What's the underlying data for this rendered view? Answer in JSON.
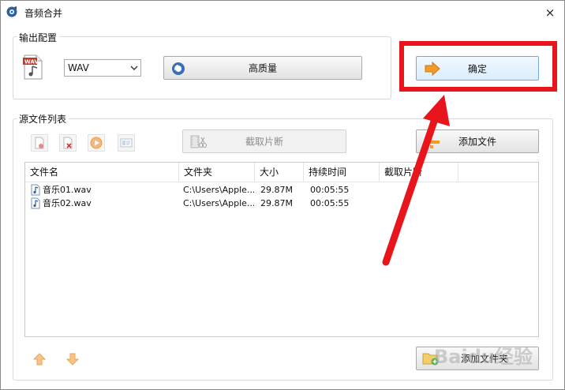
{
  "window": {
    "title": "音频合并",
    "close_glyph": "×"
  },
  "output_group": {
    "label": "输出配置",
    "format_icon_text": "WAV",
    "format_select": {
      "value": "WAV"
    },
    "quality_button": "高质量",
    "ok_button": "确定"
  },
  "source_group": {
    "label": "源文件列表",
    "clip_button": "截取片断",
    "add_file_button": "添加文件",
    "add_folder_button": "添加文件夹"
  },
  "list": {
    "columns": [
      "文件名",
      "文件夹",
      "大小",
      "持续时间",
      "截取片断"
    ],
    "rows": [
      {
        "name": "音乐01.wav",
        "folder": "C:\\Users\\Apple...",
        "size": "29.87M",
        "duration": "00:05:55",
        "clip": ""
      },
      {
        "name": "音乐02.wav",
        "folder": "C:\\Users\\Apple...",
        "size": "29.87M",
        "duration": "00:05:55",
        "clip": ""
      }
    ]
  },
  "watermark": "Baidu经验",
  "colors": {
    "annotation_red": "#e8151d",
    "accent_orange": "#f39a2b"
  }
}
